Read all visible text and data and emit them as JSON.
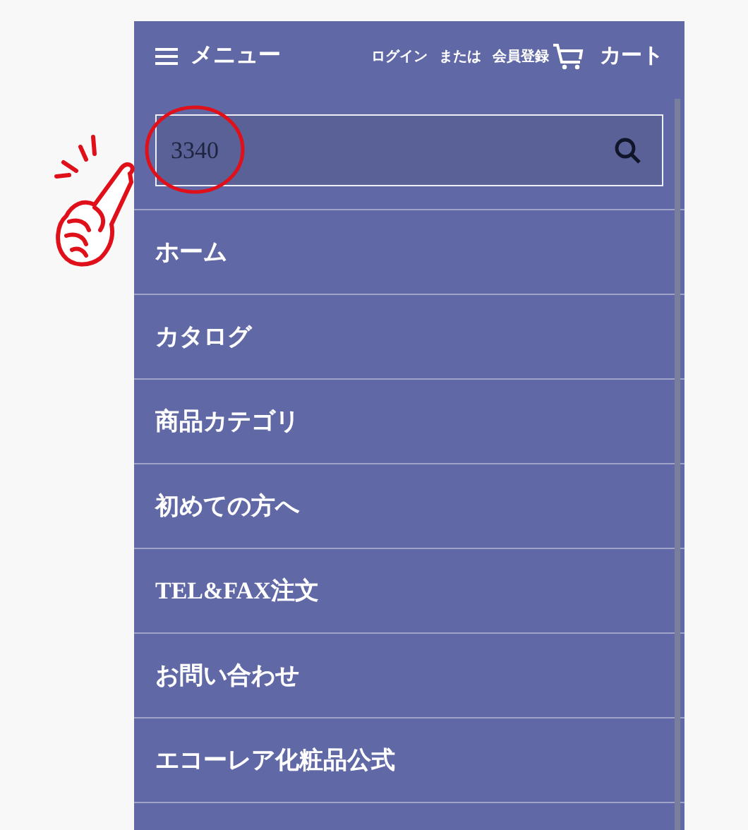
{
  "header": {
    "menu_label": "メニュー",
    "login": "ログイン",
    "or": "または",
    "register": "会員登録",
    "cart": "カート"
  },
  "search": {
    "value": "3340"
  },
  "menu_items": [
    {
      "label": "ホーム"
    },
    {
      "label": "カタログ"
    },
    {
      "label": "商品カテゴリ"
    },
    {
      "label": "初めての方へ"
    },
    {
      "label": "TEL&FAX注文"
    },
    {
      "label": "お問い合わせ"
    },
    {
      "label": "エコーレア化粧品公式"
    }
  ]
}
